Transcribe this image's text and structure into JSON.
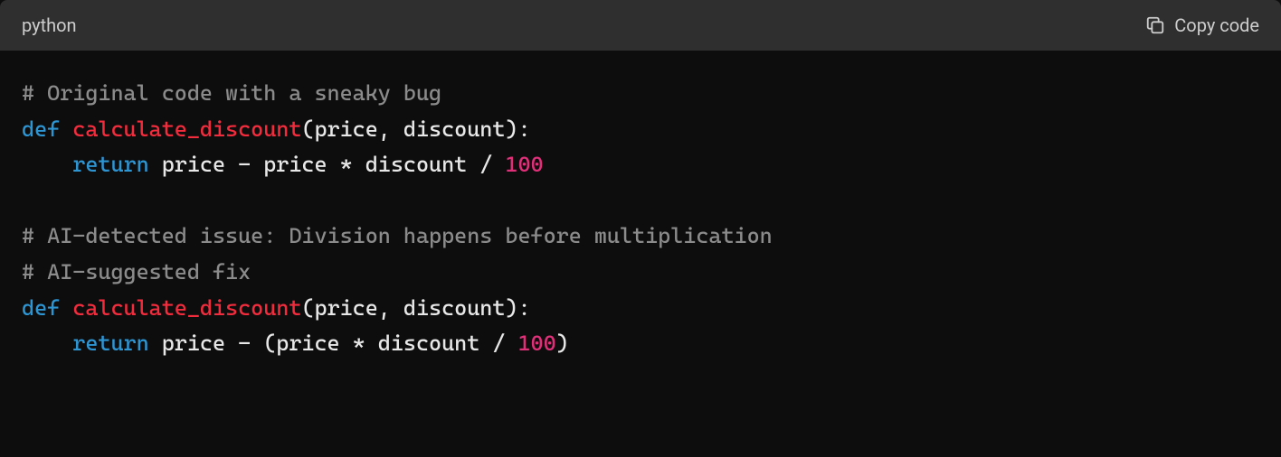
{
  "header": {
    "language": "python",
    "copy_label": "Copy code"
  },
  "code": {
    "tokens": {
      "comment1": "# Original code with a sneaky bug",
      "kw_def1": "def",
      "sp1": " ",
      "fn1": "calculate_discount",
      "sig1": "(price, discount):",
      "indent1": "    ",
      "kw_return1": "return",
      "expr1": " price - price * discount / ",
      "num1": "100",
      "comment2": "# AI-detected issue: Division happens before multiplication",
      "comment3": "# AI-suggested fix",
      "kw_def2": "def",
      "sp2": " ",
      "fn2": "calculate_discount",
      "sig2": "(price, discount):",
      "indent2": "    ",
      "kw_return2": "return",
      "expr2a": " price - (price * discount / ",
      "num2": "100",
      "expr2b": ")"
    }
  }
}
